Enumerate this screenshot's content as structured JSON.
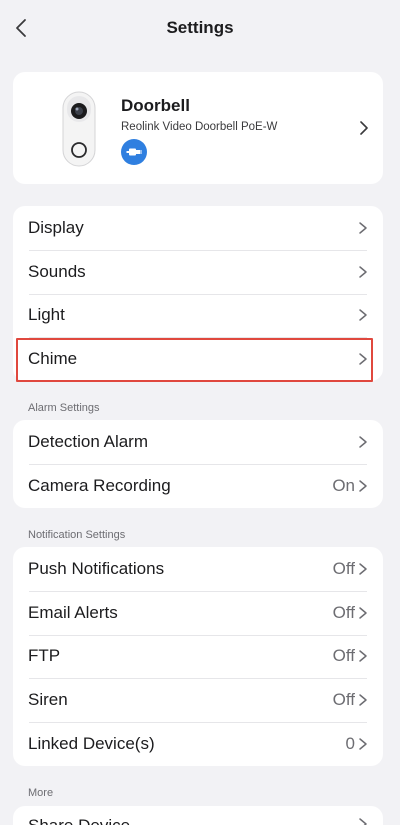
{
  "header": {
    "title": "Settings"
  },
  "device": {
    "name": "Doorbell",
    "model": "Reolink Video Doorbell PoE-W",
    "badge_color": "#2f7fe0"
  },
  "general": {
    "items": [
      {
        "label": "Display"
      },
      {
        "label": "Sounds"
      },
      {
        "label": "Light"
      },
      {
        "label": "Chime"
      }
    ]
  },
  "alarm": {
    "section_label": "Alarm Settings",
    "items": [
      {
        "label": "Detection Alarm",
        "value": ""
      },
      {
        "label": "Camera Recording",
        "value": "On"
      }
    ]
  },
  "notifications": {
    "section_label": "Notification Settings",
    "items": [
      {
        "label": "Push Notifications",
        "value": "Off"
      },
      {
        "label": "Email Alerts",
        "value": "Off"
      },
      {
        "label": "FTP",
        "value": "Off"
      },
      {
        "label": "Siren",
        "value": "Off"
      },
      {
        "label": "Linked Device(s)",
        "value": "0"
      }
    ]
  },
  "more": {
    "section_label": "More",
    "items": [
      {
        "label": "Share Device"
      }
    ]
  },
  "highlight_color": "#e0483e"
}
